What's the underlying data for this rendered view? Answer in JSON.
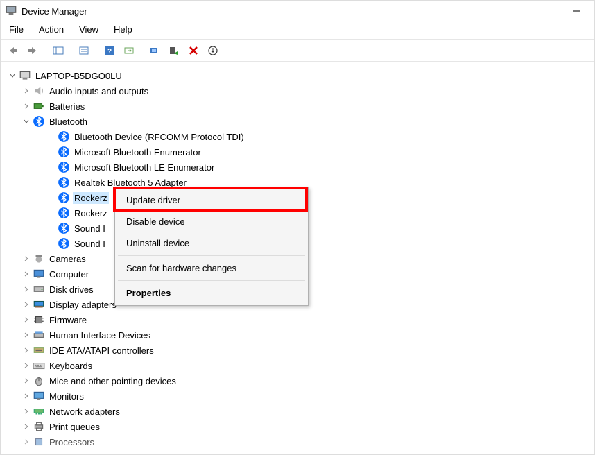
{
  "window": {
    "title": "Device Manager"
  },
  "menu": {
    "file": "File",
    "action": "Action",
    "view": "View",
    "help": "Help"
  },
  "tree": {
    "root": "LAPTOP-B5DGO0LU",
    "audio": "Audio inputs and outputs",
    "batteries": "Batteries",
    "bluetooth": "Bluetooth",
    "bt_items": [
      "Bluetooth Device (RFCOMM Protocol TDI)",
      "Microsoft Bluetooth Enumerator",
      "Microsoft Bluetooth LE Enumerator",
      "Realtek Bluetooth 5 Adapter",
      "Rockerz",
      "Rockerz",
      "Sound I",
      "Sound I"
    ],
    "cameras": "Cameras",
    "computer": "Computer",
    "disk": "Disk drives",
    "display": "Display adapters",
    "firmware": "Firmware",
    "hid": "Human Interface Devices",
    "ide": "IDE ATA/ATAPI controllers",
    "keyboards": "Keyboards",
    "mice": "Mice and other pointing devices",
    "monitors": "Monitors",
    "network": "Network adapters",
    "print": "Print queues",
    "processors": "Processors"
  },
  "context_menu": {
    "update": "Update driver",
    "disable": "Disable device",
    "uninstall": "Uninstall device",
    "scan": "Scan for hardware changes",
    "properties": "Properties"
  }
}
